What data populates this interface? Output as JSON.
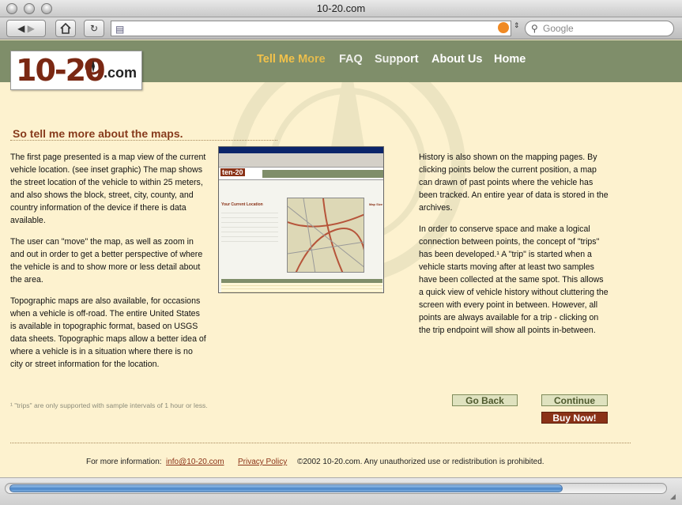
{
  "window": {
    "title": "10-20.com"
  },
  "browser": {
    "address_url": "",
    "search_placeholder": "Google"
  },
  "site": {
    "logo_text": "10-20",
    "logo_suffix": ".com",
    "nav": [
      {
        "label": "Tell Me More",
        "active": true
      },
      {
        "label": "FAQ"
      },
      {
        "label": "Support"
      },
      {
        "label": "About Us"
      },
      {
        "label": "Home"
      }
    ]
  },
  "content": {
    "title": "So tell me more about the maps.",
    "left_paragraphs": [
      "The first page presented is a map view of the current vehicle location. (see inset graphic) The map shows the street location of the vehicle to within 25 meters, and also shows the block, street, city, county, and country information of the device if there is data available.",
      "The user can \"move\" the map, as well as zoom in and out in order to get a better perspective of where the vehicle is and to show more or less detail about the area.",
      "Topographic maps are also available, for occasions when a vehicle is off-road. The entire United States is available in topographic format, based on USGS data sheets. Topographic maps allow a better idea of where a vehicle is in a situation where there is no city or street information for the location."
    ],
    "right_paragraphs": [
      "History is also shown on the mapping pages. By clicking points below the current position, a map can drawn of past points where the vehicle has been tracked. An entire year of data is stored in the archives.",
      "In order to conserve space and make a logical connection between points, the concept of \"trips\" has been developed.¹ A \"trip\" is started when a vehicle starts moving after at least two samples have been collected at the same spot. This allows a quick view of vehicle history without cluttering the screen with every point in between. However, all points are always available for a trip - clicking on the trip endpoint will show all points in-between."
    ],
    "footnote": "¹ \"trips\" are only supported with sample intervals of 1 hour or less.",
    "inset": {
      "logo": "ten-20",
      "heading": "Your Current Location",
      "map_size_label": "Map Size"
    }
  },
  "buttons": {
    "back": "Go Back",
    "continue": "Continue",
    "buy": "Buy Now!"
  },
  "footer": {
    "info_label": "For more information:",
    "email": "info@10-20.com",
    "privacy": "Privacy Policy",
    "copyright": "©2002 10-20.com. Any unauthorized use or redistribution is prohibited."
  },
  "colors": {
    "header_bg": "#7f8e6a",
    "page_bg": "#fdf2cf",
    "active_nav": "#f3c24a",
    "title": "#873b1c",
    "buy_button": "#8a3217"
  }
}
